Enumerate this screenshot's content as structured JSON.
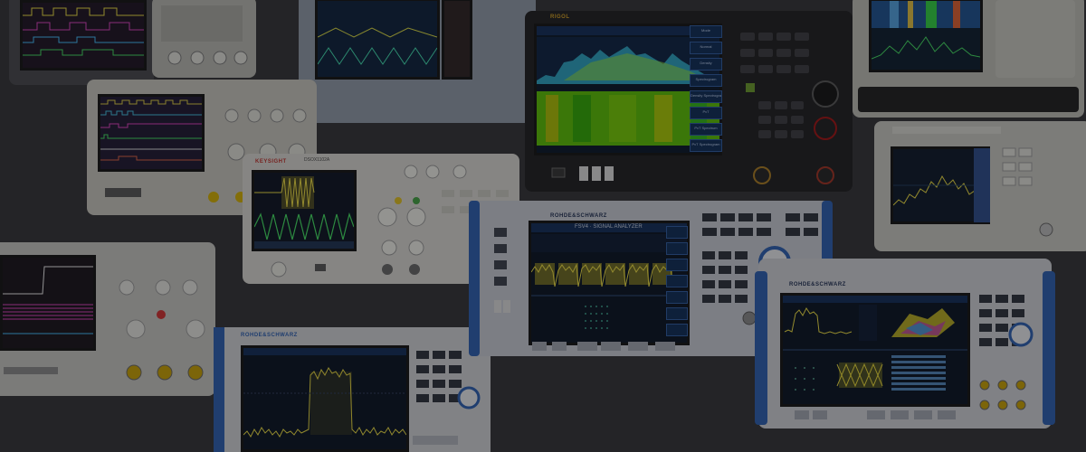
{
  "image": {
    "instruments": [
      {
        "brand": "",
        "model": "",
        "kind": "oscilloscope",
        "colors": {
          "body": "#45464a",
          "screen": "#1a1020"
        }
      },
      {
        "brand": "",
        "model": "",
        "kind": "benchtop-meter",
        "colors": {
          "body": "#b9b9b2"
        }
      },
      {
        "brand": "",
        "model": "",
        "kind": "oscilloscope",
        "colors": {
          "body": "#8f9aa8",
          "screen": "#0a1e3a"
        }
      },
      {
        "brand": "RIGOL",
        "model": "",
        "kind": "real-time-spectrum-analyzer",
        "colors": {
          "body": "#1c1c1e",
          "accent": "#b8860b"
        },
        "softkeys": [
          "Mode",
          "Normal",
          "Density",
          "Spectrogram",
          "Density Spectrogram",
          "PvT",
          "PvT Spectrum",
          "PvT Spectrogram"
        ]
      },
      {
        "brand": "",
        "model": "",
        "kind": "spectrum-analyzer",
        "colors": {
          "body": "#bdbdb6"
        }
      },
      {
        "brand": "",
        "model": "",
        "kind": "mixed-signal-oscilloscope",
        "colors": {
          "body": "#c8c7be"
        }
      },
      {
        "brand": "KEYSIGHT",
        "model": "DSOX1102A",
        "kind": "oscilloscope",
        "colors": {
          "body": "#d9d8d2",
          "accent": "#e03a2a"
        }
      },
      {
        "brand": "ROHDE&SCHWARZ",
        "model": "FSV4 · SIGNAL ANALYZER",
        "kind": "signal-analyzer",
        "colors": {
          "body": "#c8ccd4",
          "accent": "#2a5db0"
        }
      },
      {
        "brand": "",
        "model": "",
        "kind": "spectrum-analyzer",
        "colors": {
          "body": "#c9c8c1"
        }
      },
      {
        "brand": "",
        "model": "",
        "kind": "oscilloscope",
        "colors": {
          "body": "#c6c6c2"
        }
      },
      {
        "brand": "ROHDE&SCHWARZ",
        "model": "",
        "kind": "spectrum-analyzer",
        "colors": {
          "body": "#d0d2d6",
          "accent": "#2a5db0"
        }
      },
      {
        "brand": "ROHDE&SCHWARZ",
        "model": "",
        "kind": "signal-and-spectrum-analyzer",
        "colors": {
          "body": "#cfd1d6",
          "accent": "#2a5db0"
        }
      }
    ],
    "overlay": {
      "tone": "dark",
      "color": "#121216"
    }
  }
}
